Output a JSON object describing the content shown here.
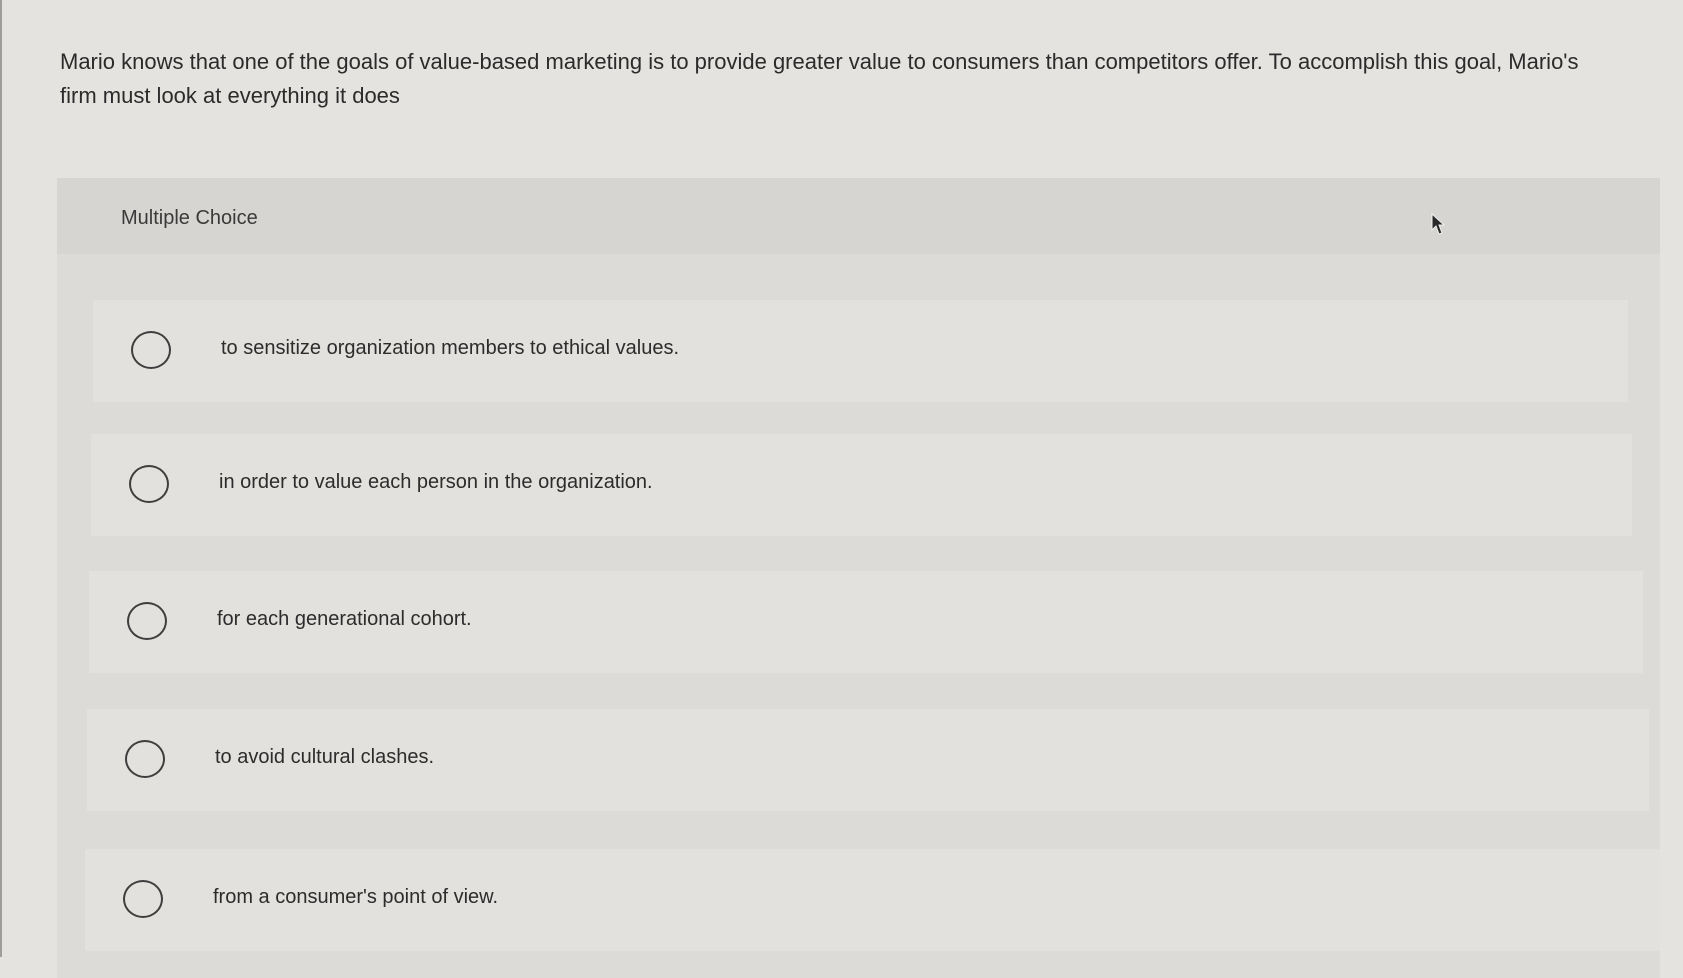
{
  "question": {
    "text": "Mario knows that one of the goals of value-based marketing is to provide greater value to consumers than competitors offer. To accomplish this goal, Mario's firm must look at everything it does"
  },
  "multiple_choice": {
    "title": "Multiple Choice",
    "options": [
      {
        "label": "to sensitize organization members to ethical values.",
        "selected": false
      },
      {
        "label": "in order to value each person in the organization.",
        "selected": false
      },
      {
        "label": "for each generational cohort.",
        "selected": false
      },
      {
        "label": "to avoid cultural clashes.",
        "selected": false
      },
      {
        "label": "from a consumer's point of view.",
        "selected": false
      }
    ]
  },
  "icons": {
    "radio": "radio-unselected-icon",
    "cursor": "mouse-pointer-icon"
  },
  "colors": {
    "background": "#e4e3e0",
    "panel": "#dcdbd8",
    "option_row": "#e2e1de",
    "text": "#2b2b2b"
  }
}
